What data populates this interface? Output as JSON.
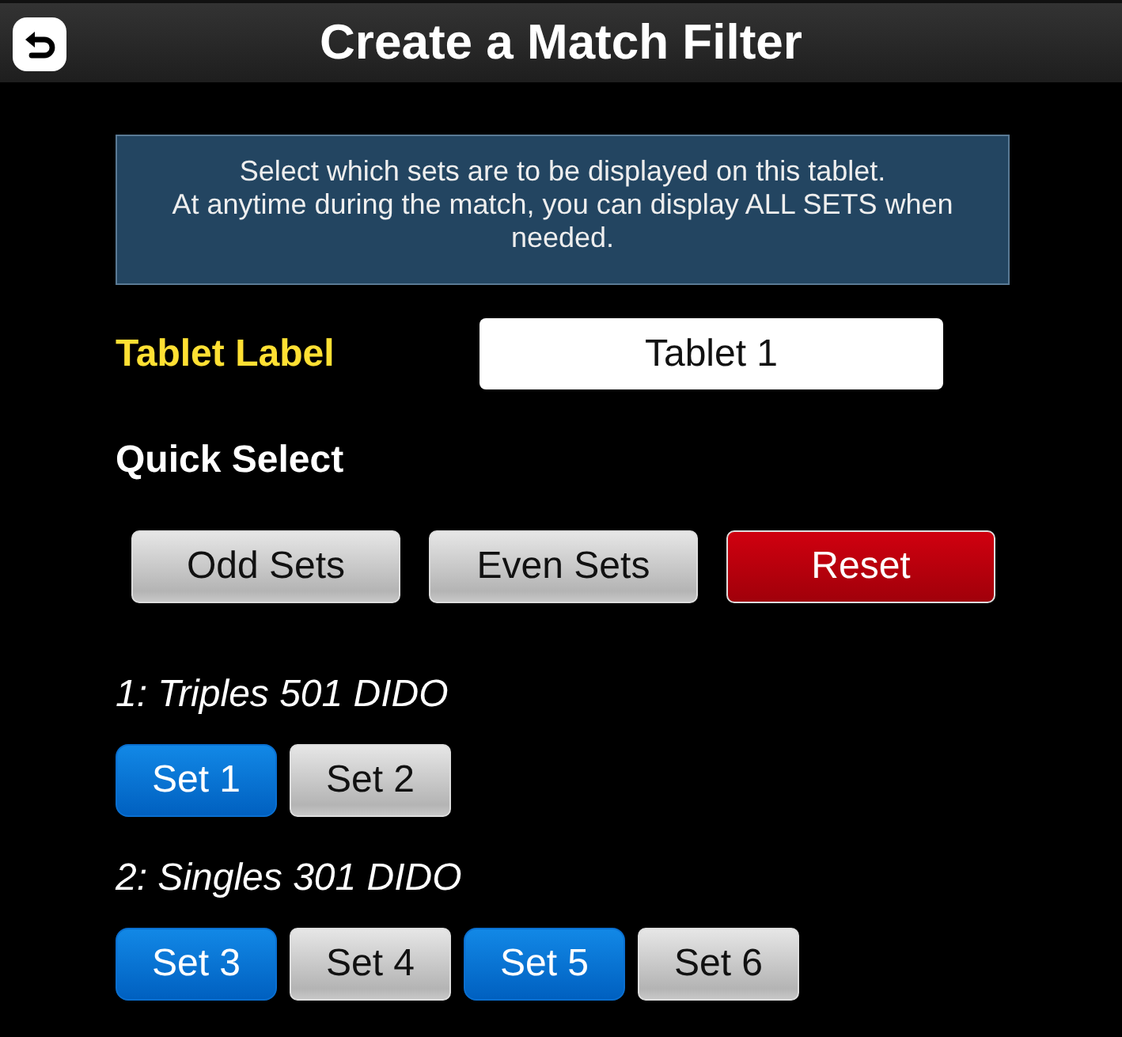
{
  "header": {
    "title": "Create a Match Filter"
  },
  "info": "Select which sets are to be displayed on this tablet.\nAt anytime during the match, you can display ALL SETS when needed.",
  "tablet_label": {
    "label": "Tablet Label",
    "value": "Tablet 1"
  },
  "quick_select": {
    "heading": "Quick Select",
    "buttons": [
      {
        "label": "Odd Sets",
        "kind": "neutral"
      },
      {
        "label": "Even Sets",
        "kind": "neutral"
      },
      {
        "label": "Reset",
        "kind": "danger"
      }
    ]
  },
  "matches": [
    {
      "title": "1: Triples 501 DIDO",
      "sets": [
        {
          "label": "Set 1",
          "selected": true
        },
        {
          "label": "Set 2",
          "selected": false
        }
      ]
    },
    {
      "title": "2: Singles 301 DIDO",
      "sets": [
        {
          "label": "Set 3",
          "selected": true
        },
        {
          "label": "Set 4",
          "selected": false
        },
        {
          "label": "Set 5",
          "selected": true
        },
        {
          "label": "Set 6",
          "selected": false
        }
      ]
    }
  ]
}
